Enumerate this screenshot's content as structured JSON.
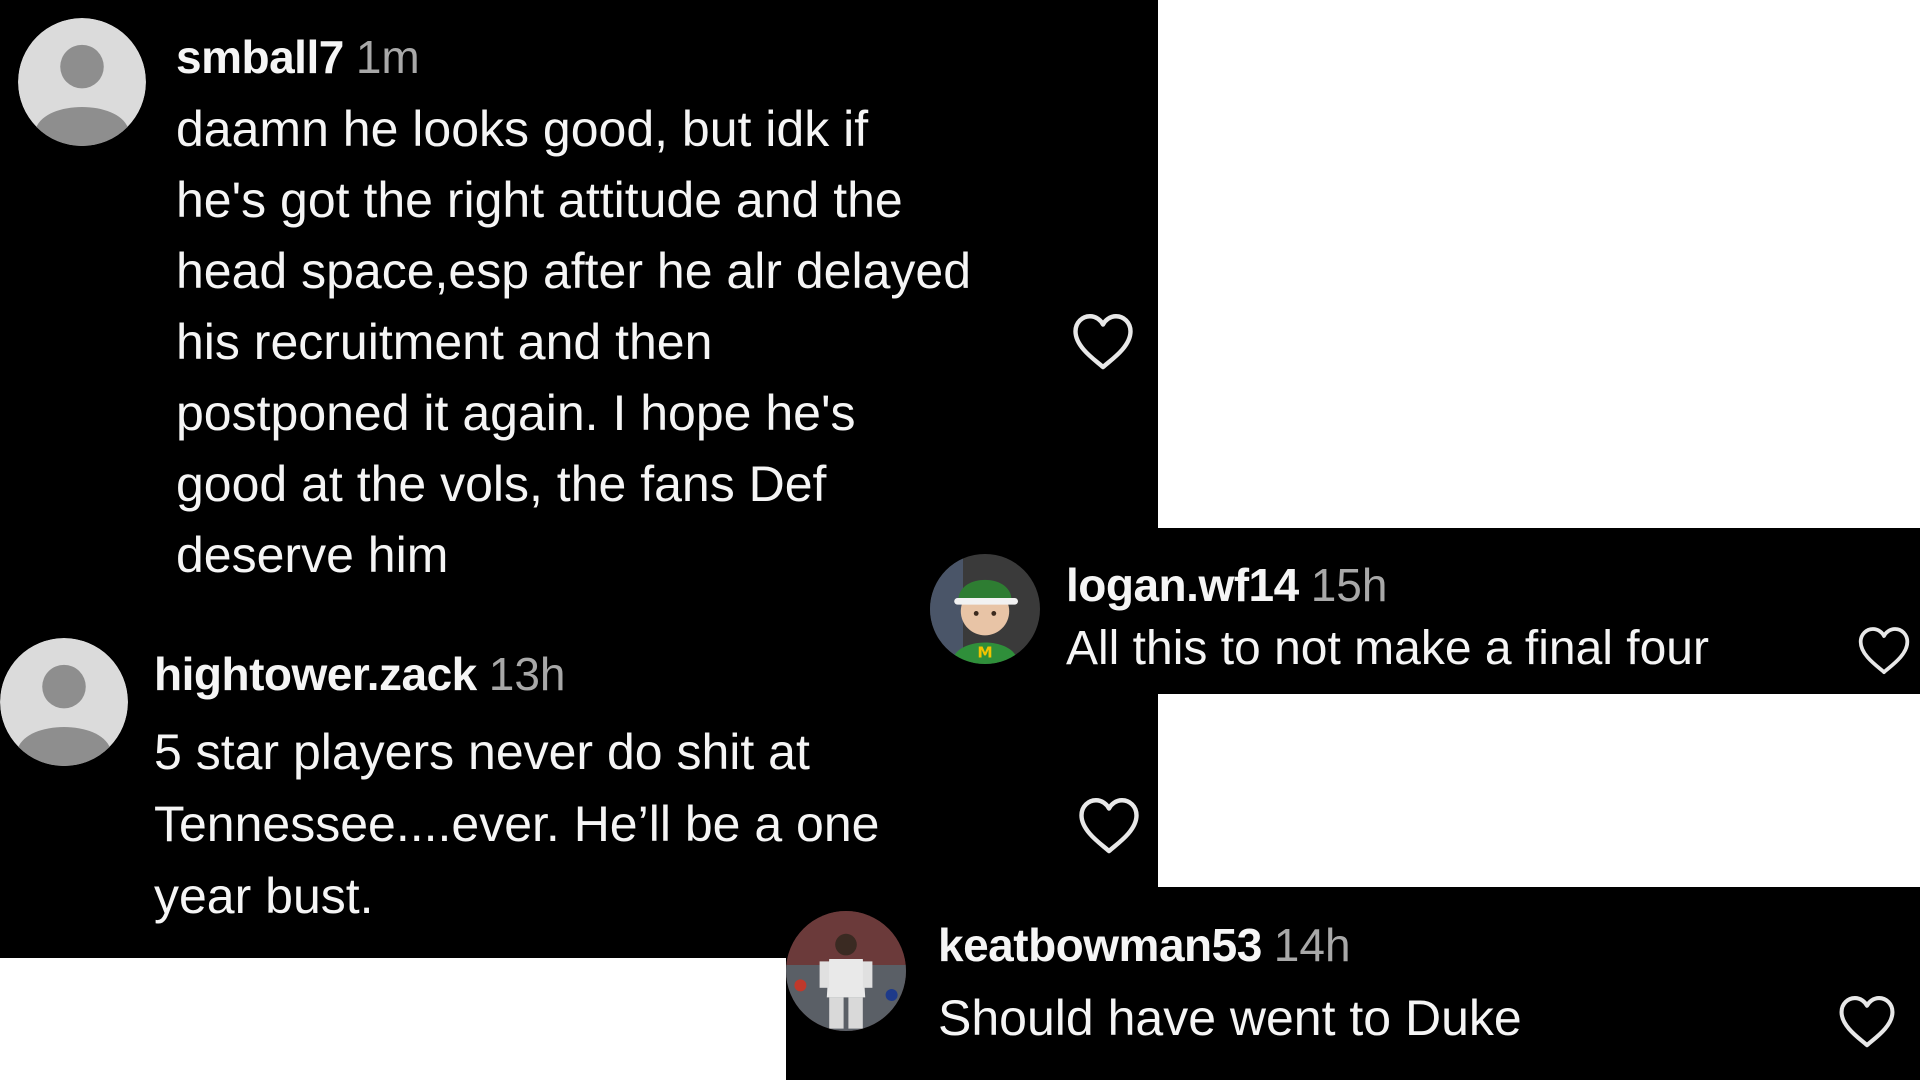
{
  "comments": [
    {
      "username": "smball7",
      "time": "1m",
      "text": "daamn he looks good, but idk if\nhe's got the right attitude and the\nhead space,esp after he alr delayed\nhis recruitment and then\npostponed it again. I hope he's\ngood at the vols, the fans Def\ndeserve him",
      "avatar": "default-avatar-icon"
    },
    {
      "username": "hightower.zack",
      "time": "13h",
      "text": "5 star players never do shit at\nTennessee....ever. He’ll be a one\nyear bust.",
      "avatar": "default-avatar-icon"
    },
    {
      "username": "logan.wf14",
      "time": "15h",
      "text": "All this to not make a final four",
      "avatar": "child-photo-avatar"
    },
    {
      "username": "keatbowman53",
      "time": "14h",
      "text": "Should have went to Duke",
      "avatar": "baseball-player-photo-avatar"
    }
  ],
  "icons": {
    "like": "heart-outline-icon"
  },
  "colors": {
    "background": "#000000",
    "text": "#f5f5f5",
    "muted": "#a8a8a8",
    "avatar_bg": "#dbdbdb",
    "avatar_fg": "#8e8e8e"
  }
}
